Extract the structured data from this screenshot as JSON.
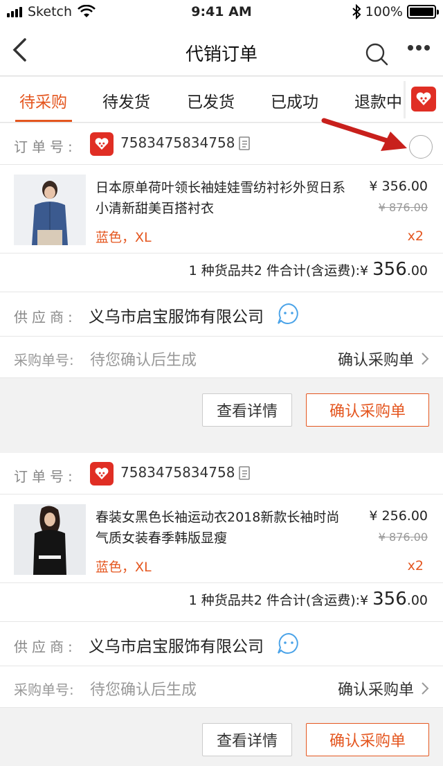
{
  "status_bar": {
    "carrier": "Sketch",
    "time": "9:41 AM",
    "battery": "100%"
  },
  "nav": {
    "title": "代销订单"
  },
  "tabs": [
    {
      "label": "待采购",
      "active": true
    },
    {
      "label": "已发货"
    },
    {
      "label": "待发货"
    },
    {
      "label": "已成功"
    },
    {
      "label": "退款中"
    }
  ],
  "orders": [
    {
      "order_label": "订单号:",
      "order_no": "7583475834758",
      "product": {
        "name": "日本原单荷叶领长袖娃娃雪纺衬衫外贸日系小清新甜美百搭衬衣",
        "variant": "蓝色，XL",
        "price": "¥ 356.00",
        "original_price": "¥ 876.00",
        "qty": "x2"
      },
      "total": {
        "prefix": "1 种货品共2 件合计(含运费):¥",
        "amount": "356",
        "decimal": ".00"
      },
      "supplier_label": "供应商:",
      "supplier": "义乌市启宝服饰有限公司",
      "po_label": "采购单号:",
      "po_value": "待您确认后生成",
      "confirm_link": "确认采购单",
      "btn_detail": "查看详情",
      "btn_confirm": "确认采购单"
    },
    {
      "order_label": "订单号:",
      "order_no": "7583475834758",
      "product": {
        "name": "春装女黑色长袖运动衣2018新款长袖时尚气质女装春季韩版显瘦",
        "variant": "蓝色，XL",
        "price": "¥ 256.00",
        "original_price": "¥ 876.00",
        "qty": "x2"
      },
      "total": {
        "prefix": "1 种货品共2 件合计(含运费):¥",
        "amount": "356",
        "decimal": ".00"
      },
      "supplier_label": "供应商:",
      "supplier": "义乌市启宝服饰有限公司",
      "po_label": "采购单号:",
      "po_value": "待您确认后生成",
      "confirm_link": "确认采购单",
      "btn_detail": "查看详情",
      "btn_confirm": "确认采购单"
    }
  ],
  "colors": {
    "accent": "#e4561f",
    "pdd_red": "#e02e24",
    "annotation_arrow": "#c8201c"
  }
}
